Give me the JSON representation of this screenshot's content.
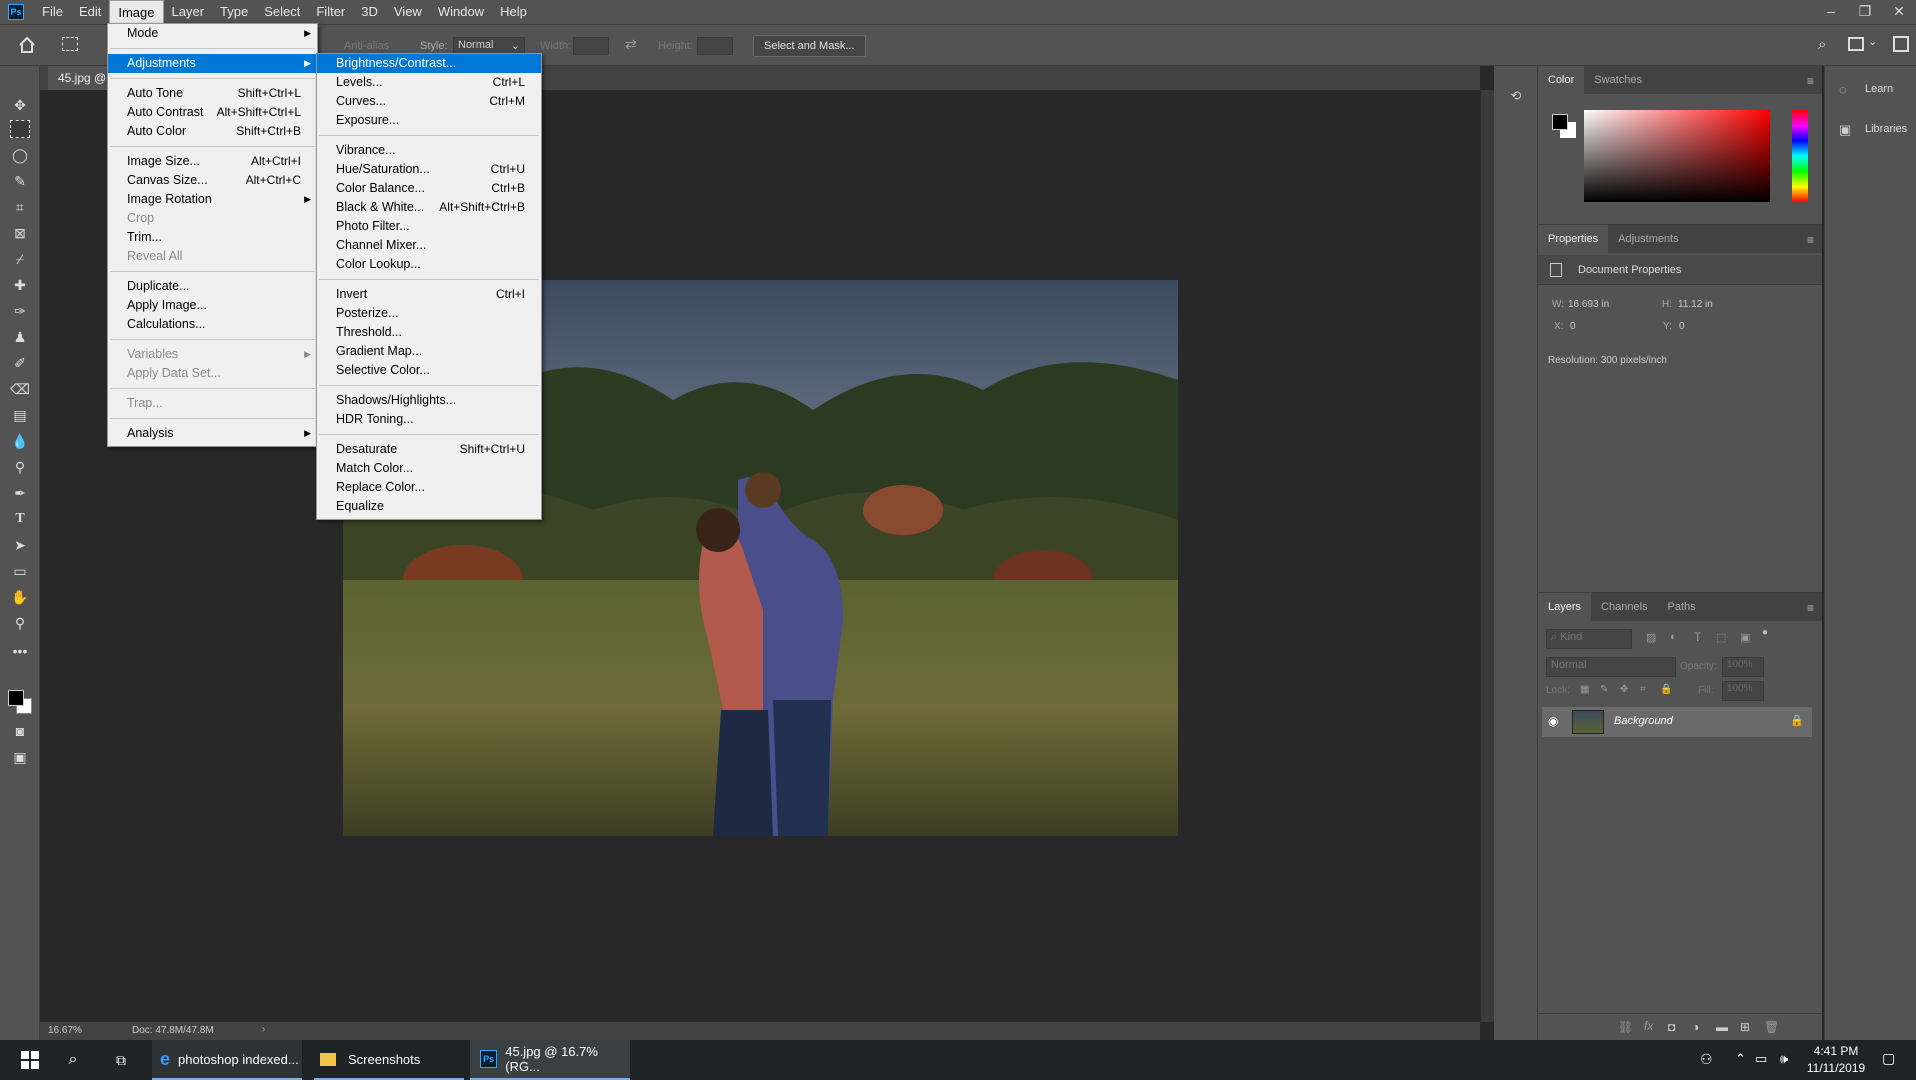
{
  "menubar": {
    "logo": "Ps",
    "items": [
      "File",
      "Edit",
      "Image",
      "Layer",
      "Type",
      "Select",
      "Filter",
      "3D",
      "View",
      "Window",
      "Help"
    ]
  },
  "window_controls": {
    "minimize": "–",
    "restore": "❐",
    "close": "✕"
  },
  "options": {
    "antialias_label": "Anti-alias",
    "style_label": "Style:",
    "style_value": "Normal",
    "width_label": "Width:",
    "height_label": "Height:",
    "select_mask": "Select and Mask..."
  },
  "doc_tab": {
    "label": "45.jpg @ 1"
  },
  "status": {
    "zoom": "16.67%",
    "doc": "Doc: 47.8M/47.8M"
  },
  "image_menu": [
    {
      "label": "Mode",
      "submenu": true
    },
    {
      "sep": true
    },
    {
      "label": "Adjustments",
      "submenu": true,
      "highlight": true
    },
    {
      "sep": true
    },
    {
      "label": "Auto Tone",
      "shortcut": "Shift+Ctrl+L"
    },
    {
      "label": "Auto Contrast",
      "shortcut": "Alt+Shift+Ctrl+L"
    },
    {
      "label": "Auto Color",
      "shortcut": "Shift+Ctrl+B"
    },
    {
      "sep": true
    },
    {
      "label": "Image Size...",
      "shortcut": "Alt+Ctrl+I"
    },
    {
      "label": "Canvas Size...",
      "shortcut": "Alt+Ctrl+C"
    },
    {
      "label": "Image Rotation",
      "submenu": true
    },
    {
      "label": "Crop",
      "disabled": true
    },
    {
      "label": "Trim..."
    },
    {
      "label": "Reveal All",
      "disabled": true
    },
    {
      "sep": true
    },
    {
      "label": "Duplicate..."
    },
    {
      "label": "Apply Image..."
    },
    {
      "label": "Calculations..."
    },
    {
      "sep": true
    },
    {
      "label": "Variables",
      "submenu": true,
      "disabled": true
    },
    {
      "label": "Apply Data Set...",
      "disabled": true
    },
    {
      "sep": true
    },
    {
      "label": "Trap...",
      "disabled": true
    },
    {
      "sep": true
    },
    {
      "label": "Analysis",
      "submenu": true
    }
  ],
  "adjustments_menu": [
    {
      "label": "Brightness/Contrast...",
      "highlight": true
    },
    {
      "label": "Levels...",
      "shortcut": "Ctrl+L"
    },
    {
      "label": "Curves...",
      "shortcut": "Ctrl+M"
    },
    {
      "label": "Exposure..."
    },
    {
      "sep": true
    },
    {
      "label": "Vibrance..."
    },
    {
      "label": "Hue/Saturation...",
      "shortcut": "Ctrl+U"
    },
    {
      "label": "Color Balance...",
      "shortcut": "Ctrl+B"
    },
    {
      "label": "Black & White...",
      "shortcut": "Alt+Shift+Ctrl+B"
    },
    {
      "label": "Photo Filter..."
    },
    {
      "label": "Channel Mixer..."
    },
    {
      "label": "Color Lookup..."
    },
    {
      "sep": true
    },
    {
      "label": "Invert",
      "shortcut": "Ctrl+I"
    },
    {
      "label": "Posterize..."
    },
    {
      "label": "Threshold..."
    },
    {
      "label": "Gradient Map..."
    },
    {
      "label": "Selective Color..."
    },
    {
      "sep": true
    },
    {
      "label": "Shadows/Highlights..."
    },
    {
      "label": "HDR Toning..."
    },
    {
      "sep": true
    },
    {
      "label": "Desaturate",
      "shortcut": "Shift+Ctrl+U"
    },
    {
      "label": "Match Color..."
    },
    {
      "label": "Replace Color..."
    },
    {
      "label": "Equalize"
    }
  ],
  "color_panel": {
    "tabs": [
      "Color",
      "Swatches"
    ]
  },
  "properties_panel": {
    "tabs": [
      "Properties",
      "Adjustments"
    ],
    "title": "Document Properties",
    "w_label": "W:",
    "w_value": "16.693 in",
    "h_label": "H:",
    "h_value": "11.12 in",
    "x_label": "X:",
    "x_value": "0",
    "y_label": "Y:",
    "y_value": "0",
    "resolution": "Resolution: 300 pixels/inch"
  },
  "layers_panel": {
    "tabs": [
      "Layers",
      "Channels",
      "Paths"
    ],
    "kind_placeholder": "Kind",
    "blend_mode": "Normal",
    "opacity_label": "Opacity:",
    "opacity_value": "100%",
    "lock_label": "Lock:",
    "fill_label": "Fill:",
    "fill_value": "100%",
    "layer_name": "Background"
  },
  "far_right": {
    "learn": "Learn",
    "libraries": "Libraries"
  },
  "taskbar": {
    "edge_label": "photoshop indexed...",
    "explorer_label": "Screenshots",
    "ps_label": "45.jpg @ 16.7% (RG...",
    "time": "4:41 PM",
    "date": "11/11/2019"
  },
  "colors": {
    "accent": "#0078d7",
    "ps_blue": "#31a8ff",
    "panel_bg": "#535353",
    "canvas_bg": "#282828"
  }
}
